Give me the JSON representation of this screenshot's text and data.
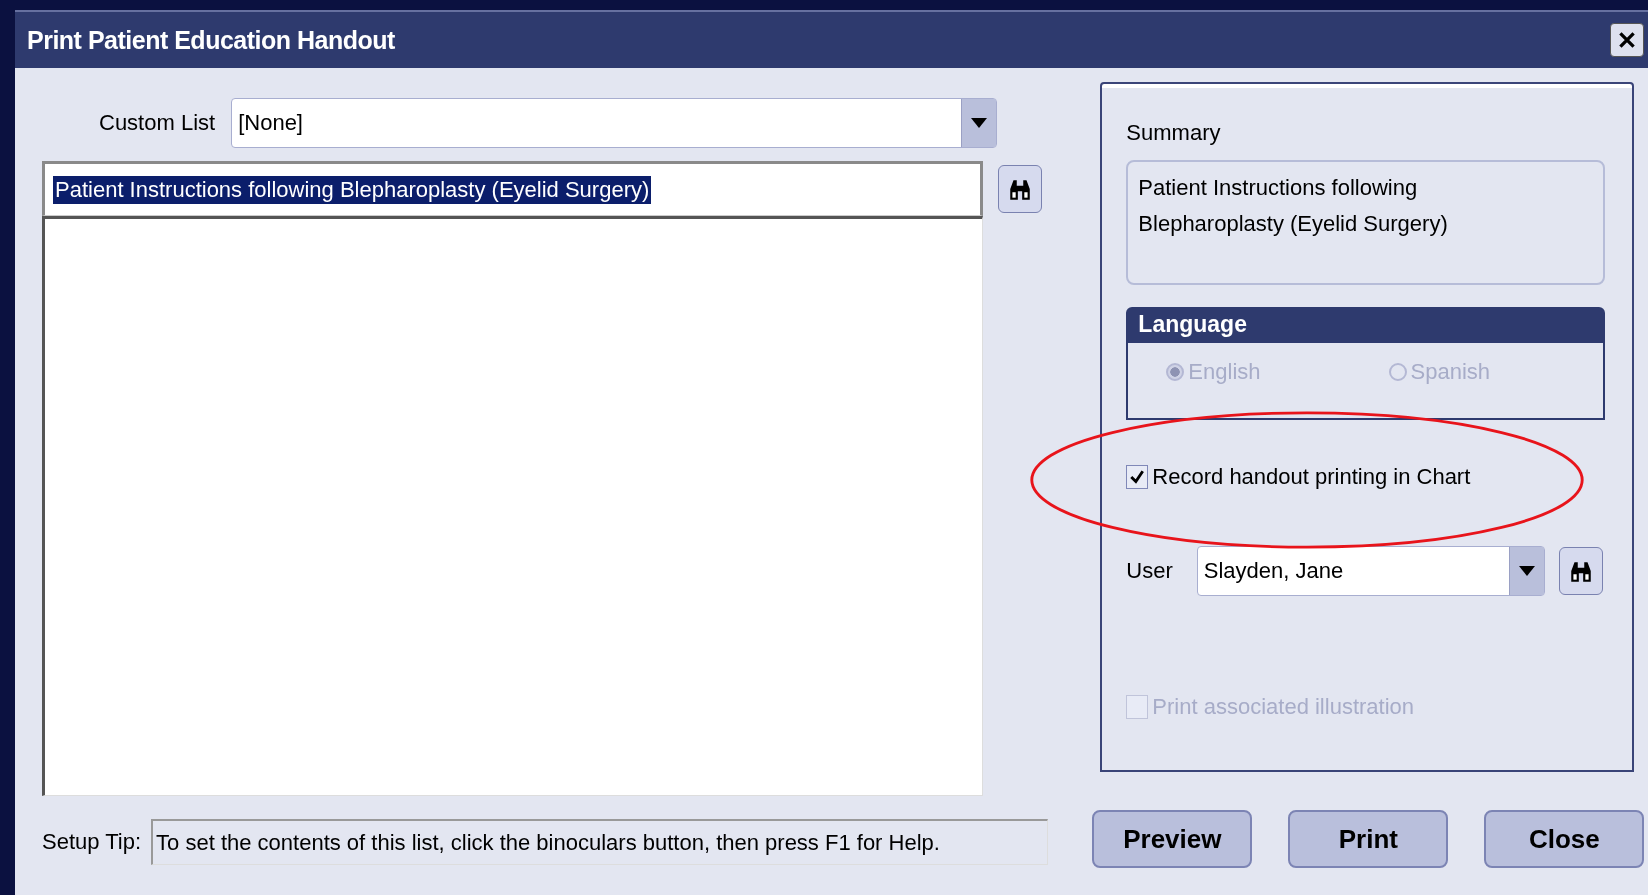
{
  "window": {
    "title": "Print Patient Education Handout"
  },
  "custom_list": {
    "label": "Custom List",
    "value": "[None]"
  },
  "search": {
    "value": "Patient Instructions following Blepharoplasty (Eyelid Surgery)",
    "text_selected": true
  },
  "setup_tip": {
    "label": "Setup Tip:",
    "value": "To set the contents of this list, click the binoculars button, then press F1 for Help."
  },
  "summary": {
    "label": "Summary",
    "text": "Patient Instructions following Blepharoplasty (Eyelid Surgery)"
  },
  "language": {
    "title": "Language",
    "options": [
      {
        "label": "English",
        "selected": true,
        "disabled": true
      },
      {
        "label": "Spanish",
        "selected": false,
        "disabled": true
      }
    ]
  },
  "record_in_chart": {
    "label": "Record handout printing in Chart",
    "checked": true,
    "disabled": false,
    "circled": true
  },
  "user": {
    "label": "User",
    "value": "Slayden, Jane"
  },
  "print_illustration": {
    "label": "Print associated illustration",
    "checked": false,
    "disabled": true
  },
  "buttons": [
    {
      "label": "Preview"
    },
    {
      "label": "Print"
    },
    {
      "label": "Close"
    }
  ]
}
